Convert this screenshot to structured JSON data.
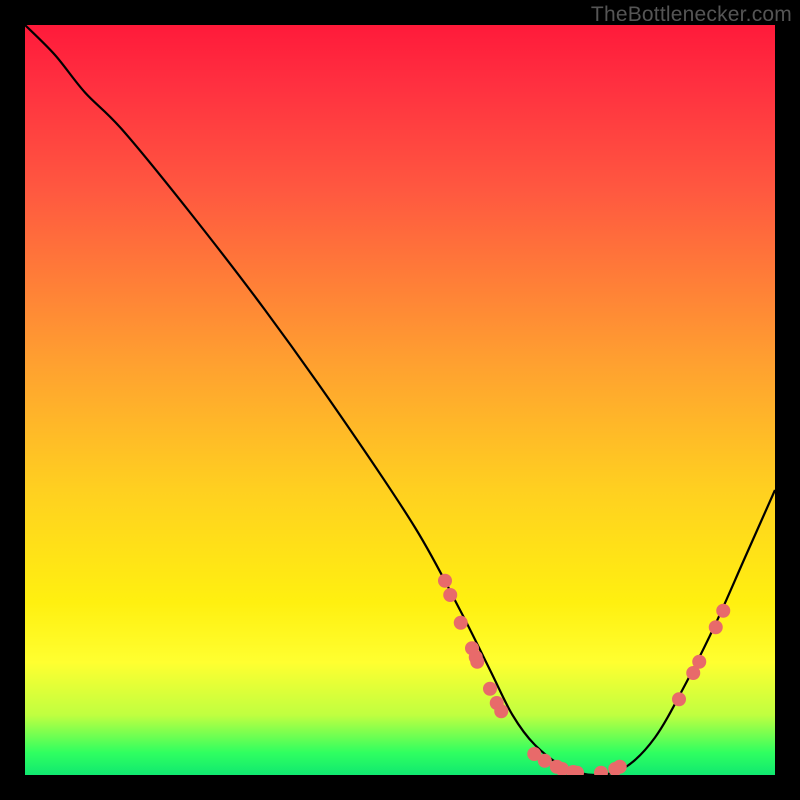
{
  "watermark": "TheBottlenecker.com",
  "chart_data": {
    "type": "line",
    "title": "",
    "xlabel": "",
    "ylabel": "",
    "xlim": [
      0,
      100
    ],
    "ylim": [
      0,
      100
    ],
    "background_gradient": {
      "top": "#ff1a3a",
      "mid_upper": "#ffa030",
      "mid_lower": "#fff010",
      "bottom": "#10e870"
    },
    "series": [
      {
        "name": "bottleneck-curve",
        "color": "#000000",
        "x": [
          0,
          4,
          8,
          13,
          22,
          32,
          42,
          52,
          58,
          62,
          65,
          68,
          72,
          76,
          80,
          84,
          88,
          92,
          96,
          100
        ],
        "y": [
          100,
          96,
          91,
          86,
          75,
          62,
          48,
          33,
          22,
          14,
          8,
          4,
          1,
          0,
          1,
          5,
          12,
          20,
          29,
          38
        ]
      }
    ],
    "markers": [
      {
        "name": "curve-point",
        "x_approx": 56.0,
        "y_approx": 25.9
      },
      {
        "name": "curve-point",
        "x_approx": 56.7,
        "y_approx": 24.0
      },
      {
        "name": "curve-point",
        "x_approx": 58.1,
        "y_approx": 20.3
      },
      {
        "name": "curve-point",
        "x_approx": 59.6,
        "y_approx": 16.9
      },
      {
        "name": "curve-point",
        "x_approx": 60.1,
        "y_approx": 15.7
      },
      {
        "name": "curve-point",
        "x_approx": 60.3,
        "y_approx": 15.1
      },
      {
        "name": "curve-point",
        "x_approx": 62.0,
        "y_approx": 11.5
      },
      {
        "name": "curve-point",
        "x_approx": 62.9,
        "y_approx": 9.6
      },
      {
        "name": "curve-point",
        "x_approx": 63.5,
        "y_approx": 8.5
      },
      {
        "name": "curve-point",
        "x_approx": 67.9,
        "y_approx": 2.8
      },
      {
        "name": "curve-point",
        "x_approx": 69.3,
        "y_approx": 1.9
      },
      {
        "name": "curve-point",
        "x_approx": 70.9,
        "y_approx": 1.1
      },
      {
        "name": "curve-point",
        "x_approx": 71.6,
        "y_approx": 0.8
      },
      {
        "name": "curve-point",
        "x_approx": 73.1,
        "y_approx": 0.4
      },
      {
        "name": "curve-point",
        "x_approx": 73.6,
        "y_approx": 0.3
      },
      {
        "name": "curve-point",
        "x_approx": 76.8,
        "y_approx": 0.3
      },
      {
        "name": "curve-point",
        "x_approx": 78.7,
        "y_approx": 0.8
      },
      {
        "name": "curve-point",
        "x_approx": 79.3,
        "y_approx": 1.1
      },
      {
        "name": "curve-point",
        "x_approx": 87.2,
        "y_approx": 10.1
      },
      {
        "name": "curve-point",
        "x_approx": 89.1,
        "y_approx": 13.6
      },
      {
        "name": "curve-point",
        "x_approx": 89.9,
        "y_approx": 15.1
      },
      {
        "name": "curve-point",
        "x_approx": 92.1,
        "y_approx": 19.7
      },
      {
        "name": "curve-point",
        "x_approx": 93.1,
        "y_approx": 21.9
      }
    ],
    "marker_color": "#e86a6a"
  }
}
